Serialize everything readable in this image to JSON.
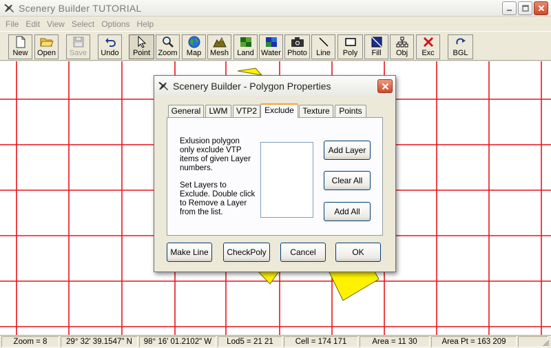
{
  "window": {
    "title": "Scenery Builder  TUTORIAL",
    "controls": [
      "minimize",
      "maximize",
      "close"
    ]
  },
  "menu": [
    "File",
    "Edit",
    "View",
    "Select",
    "Options",
    "Help"
  ],
  "toolbar": [
    {
      "name": "new",
      "label": "New",
      "icon": "new-file-icon",
      "enabled": true
    },
    {
      "name": "open",
      "label": "Open",
      "icon": "open-folder-icon",
      "enabled": true
    },
    {
      "name": "save",
      "label": "Save",
      "icon": "floppy-disk-icon",
      "enabled": false
    },
    {
      "name": "undo",
      "label": "Undo",
      "icon": "undo-arrow-icon",
      "enabled": true
    },
    {
      "name": "point",
      "label": "Point",
      "icon": "pointer-arrow-icon",
      "enabled": true,
      "pressed": true
    },
    {
      "name": "zoom",
      "label": "Zoom",
      "icon": "magnifier-icon",
      "enabled": true
    },
    {
      "name": "map",
      "label": "Map",
      "icon": "globe-icon",
      "enabled": true
    },
    {
      "name": "mesh",
      "label": "Mesh",
      "icon": "terrain-mesh-icon",
      "enabled": true
    },
    {
      "name": "land",
      "label": "Land",
      "icon": "land-class-icon",
      "enabled": true
    },
    {
      "name": "water",
      "label": "Water",
      "icon": "water-class-icon",
      "enabled": true
    },
    {
      "name": "photo",
      "label": "Photo",
      "icon": "camera-icon",
      "enabled": true
    },
    {
      "name": "line",
      "label": "Line",
      "icon": "line-tool-icon",
      "enabled": true
    },
    {
      "name": "poly",
      "label": "Poly",
      "icon": "polygon-tool-icon",
      "enabled": true
    },
    {
      "name": "fill",
      "label": "Fill",
      "icon": "fill-tool-icon",
      "enabled": true
    },
    {
      "name": "obj",
      "label": "Obj",
      "icon": "object-tree-icon",
      "enabled": true
    },
    {
      "name": "exc",
      "label": "Exc",
      "icon": "exclude-x-icon",
      "enabled": true
    },
    {
      "name": "bgl",
      "label": "BGL",
      "icon": "compile-arrow-icon",
      "enabled": true
    }
  ],
  "colors": {
    "grid_line": "#e8141c",
    "polygon_fill": "#fff200",
    "accent_tab": "#f0a33c",
    "close_button": "#cc4a2a"
  },
  "dialog": {
    "title": "Scenery Builder - Polygon Properties",
    "tabs": [
      "General",
      "LWM",
      "VTP2",
      "Exclude",
      "Texture",
      "Points"
    ],
    "active_tab": "Exclude",
    "description_1": [
      "Exlusion polygon",
      "only exclude VTP",
      "items of given Layer",
      "numbers."
    ],
    "description_2": [
      "Set Layers to",
      "Exclude. Double click",
      "to Remove a Layer",
      "from the list."
    ],
    "layer_list": [],
    "panel_buttons": {
      "add_layer": "Add Layer",
      "clear_all": "Clear All",
      "add_all": "Add All"
    },
    "footer_buttons": {
      "make_line": "Make Line",
      "check_poly": "CheckPoly",
      "cancel": "Cancel",
      "ok": "OK"
    }
  },
  "status": {
    "zoom": "Zoom = 8",
    "latitude": "29° 32' 39.1547\" N",
    "longitude": "98° 16' 01.2102\" W",
    "lod5": "Lod5 = 21 21",
    "cell": "Cell = 174 171",
    "area": "Area = 11 30",
    "area_pt": "Area Pt = 163 209"
  }
}
